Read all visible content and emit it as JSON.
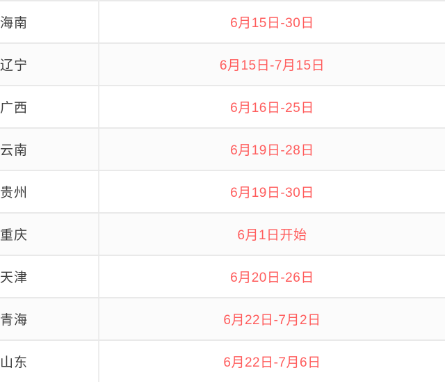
{
  "table": {
    "columns": [
      "region",
      "date_range"
    ],
    "rows": [
      {
        "region": "海南",
        "date_range": "6月15日-30日"
      },
      {
        "region": "辽宁",
        "date_range": "6月15日-7月15日"
      },
      {
        "region": "广西",
        "date_range": "6月16日-25日"
      },
      {
        "region": "云南",
        "date_range": "6月19日-28日"
      },
      {
        "region": "贵州",
        "date_range": "6月19日-30日"
      },
      {
        "region": "重庆",
        "date_range": "6月1日开始"
      },
      {
        "region": "天津",
        "date_range": "6月20日-26日"
      },
      {
        "region": "青海",
        "date_range": "6月22日-7月2日"
      },
      {
        "region": "山东",
        "date_range": "6月22日-7月6日"
      }
    ]
  },
  "colors": {
    "date_text": "#ff5c5c",
    "region_text": "#3d3d3d",
    "row_border": "#e9e9e9",
    "column_divider": "#ededed",
    "row_shade_background": "#fbfbfb",
    "row_light_background": "#ffffff"
  }
}
